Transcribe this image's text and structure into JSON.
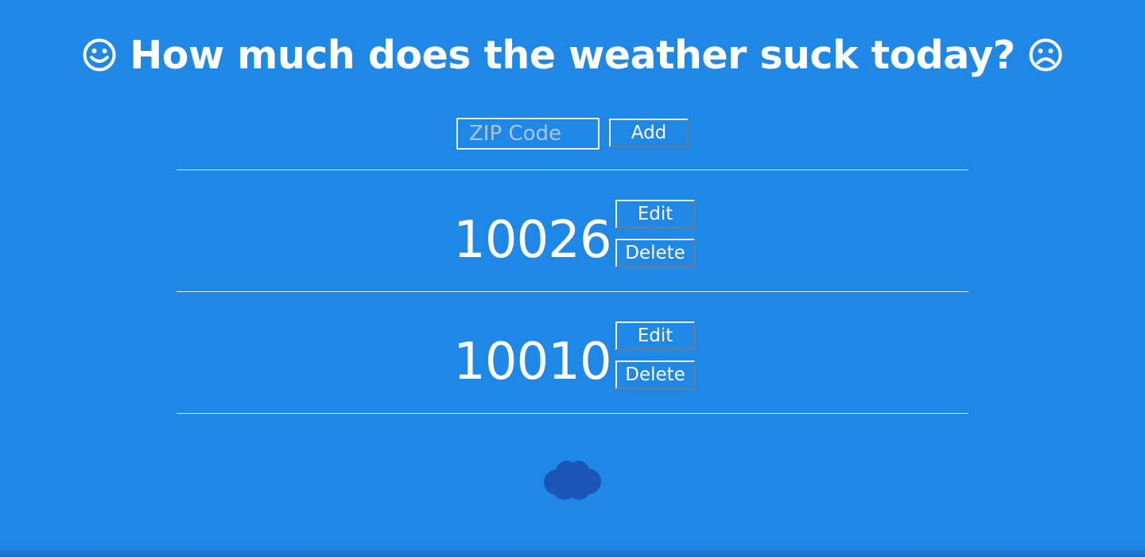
{
  "header": {
    "title": "How much does the weather suck today?",
    "left_icon": "smiley-face-icon",
    "right_icon": "frowning-face-icon"
  },
  "add_form": {
    "zip_placeholder": "ZIP Code",
    "zip_value": "",
    "add_label": "Add"
  },
  "locations": [
    {
      "zip": "10026",
      "edit_label": "Edit",
      "delete_label": "Delete"
    },
    {
      "zip": "10010",
      "edit_label": "Edit",
      "delete_label": "Delete"
    }
  ],
  "footer": {
    "icon": "cloud-icon"
  },
  "colors": {
    "background": "#1f87e5",
    "text": "#ffffff",
    "cloud": "#1a56b5"
  }
}
